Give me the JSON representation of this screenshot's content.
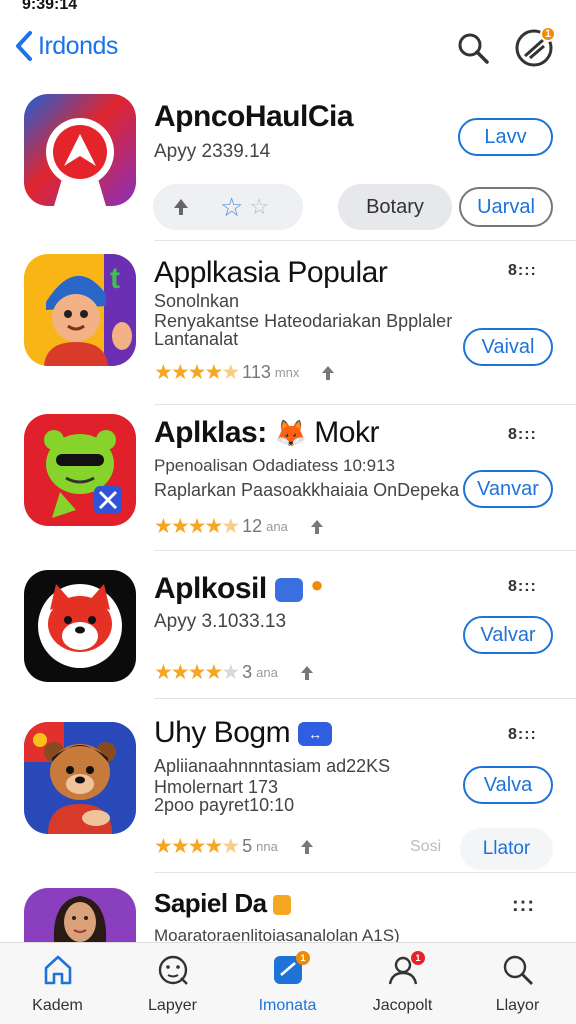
{
  "status": {
    "time": "9:39:14"
  },
  "nav": {
    "back_label": "Irdonds",
    "updates_badge": "1"
  },
  "colors": {
    "accent": "#1e73d8",
    "star": "#f5a623",
    "badge": "#f08a00"
  },
  "apps": [
    {
      "title": "ApncoHaulCia",
      "subtitle": "Apyy 2339.14",
      "button": "Lavv",
      "icon": "red-arrow-logo-icon",
      "actions": {
        "rating_hint": "upvote-star-icons",
        "secondary": "Botary",
        "primary": "Uarval"
      }
    },
    {
      "title": "Applkasia Popular",
      "desc_lines": [
        "Sonolnkan",
        "Renyakantse Hateodariakan Bpplaler",
        "Lantanalat"
      ],
      "rating": 4.5,
      "rating_count": "113",
      "rating_unit": "mnx",
      "button": "Vaival",
      "more": "8:::",
      "icon": "cartoon-boy-icon"
    },
    {
      "title": "Aplklas:",
      "title_suffix": "Mokr",
      "desc_lines": [
        "Ppenoalisan Odadiatess 10:913",
        "Raplarkan Paasoakkhaiaia OnDepeka"
      ],
      "rating": 4.5,
      "rating_count": "12",
      "rating_unit": "ana",
      "button": "Vanvar",
      "more": "8:::",
      "icon": "green-frog-mask-icon"
    },
    {
      "title": "Aplkosil",
      "subtitle": "Apyy 3.1033.13",
      "rating": 4,
      "rating_count": "3",
      "rating_unit": "ana",
      "button": "Valvar",
      "more": "8:::",
      "icon": "red-fox-icon"
    },
    {
      "title": "Uhy Bogm",
      "desc_lines": [
        "Apliianaahnnntasiam ad22KS",
        "Hmolernart 173",
        "2poo payret10:10"
      ],
      "rating": 4.5,
      "rating_count": "5",
      "rating_unit": "nna",
      "button": "Valva",
      "secondary": "Sosi",
      "tertiary": "Llator",
      "more": "8:::",
      "icon": "bear-character-icon"
    },
    {
      "title": "Sapiel Da",
      "desc_lines": [
        "Moaratoraenlitoiasanalolan A1S)"
      ],
      "more": ":::",
      "icon": "woman-portrait-icon"
    }
  ],
  "tabs": [
    {
      "label": "Kadem",
      "icon": "home-icon"
    },
    {
      "label": "Lapyer",
      "icon": "face-icon"
    },
    {
      "label": "Imonata",
      "icon": "apps-icon",
      "badge": "1"
    },
    {
      "label": "Jacopolt",
      "icon": "person-icon",
      "badge": "1"
    },
    {
      "label": "Llayor",
      "icon": "search-icon"
    }
  ]
}
